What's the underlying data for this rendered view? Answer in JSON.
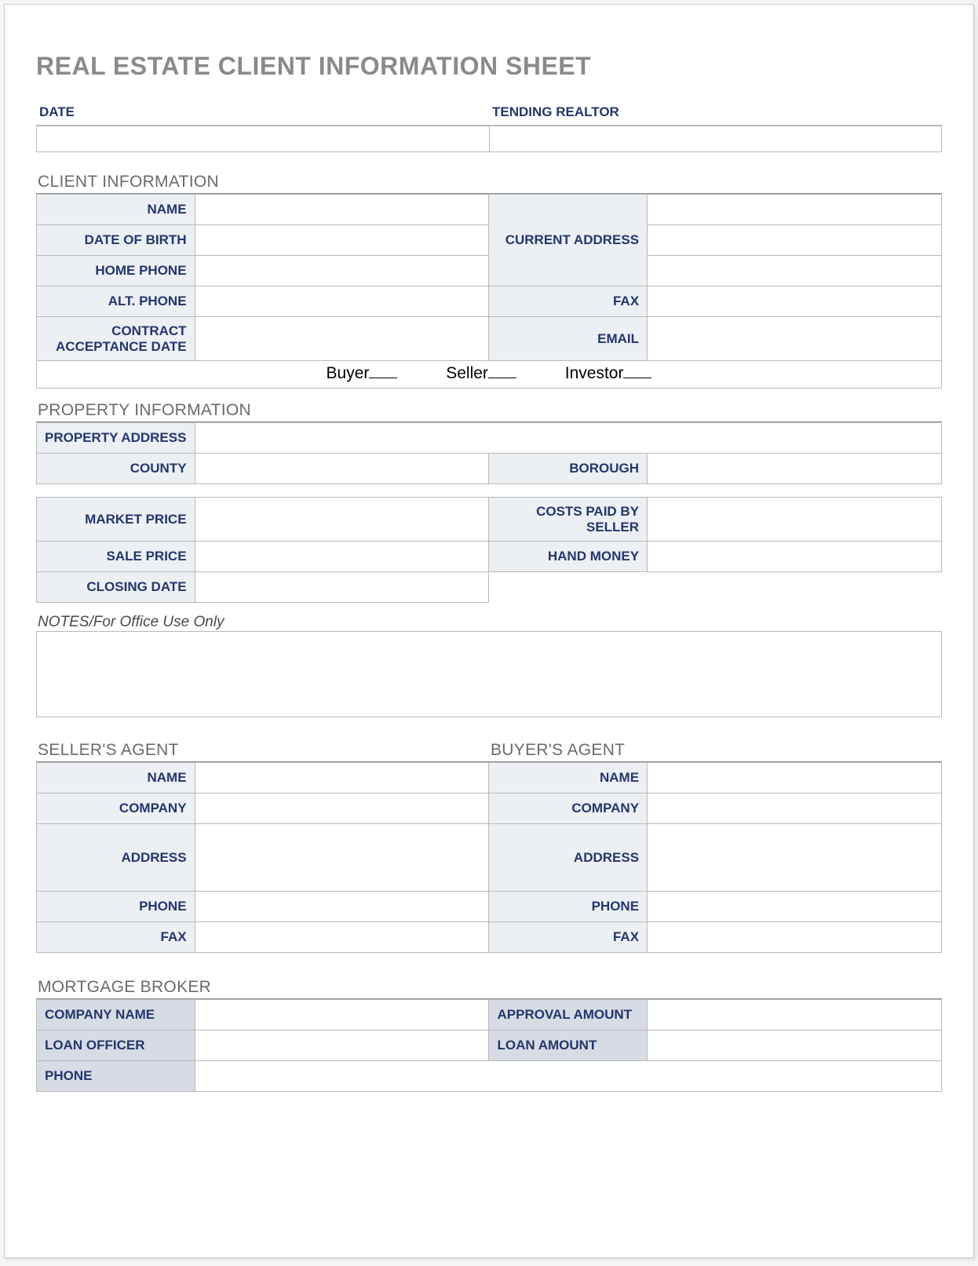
{
  "title": "REAL ESTATE CLIENT INFORMATION SHEET",
  "top": {
    "date_label": "DATE",
    "date_value": "",
    "realtor_label": "TENDING REALTOR",
    "realtor_value": ""
  },
  "client": {
    "heading": "CLIENT INFORMATION",
    "name_label": "NAME",
    "name_value": "",
    "dob_label": "DATE OF BIRTH",
    "dob_value": "",
    "home_phone_label": "HOME PHONE",
    "home_phone_value": "",
    "alt_phone_label": "ALT. PHONE",
    "alt_phone_value": "",
    "contract_label": "CONTRACT ACCEPTANCE DATE",
    "contract_value": "",
    "current_address_label": "CURRENT ADDRESS",
    "addr_line1": "",
    "addr_line2": "",
    "addr_line3": "",
    "fax_label": "FAX",
    "fax_value": "",
    "email_label": "EMAIL",
    "email_value": "",
    "roles": {
      "buyer": "Buyer",
      "seller": "Seller",
      "investor": "Investor"
    }
  },
  "property": {
    "heading": "PROPERTY INFORMATION",
    "address_label": "PROPERTY ADDRESS",
    "address_value": "",
    "county_label": "COUNTY",
    "county_value": "",
    "borough_label": "BOROUGH",
    "borough_value": "",
    "market_price_label": "MARKET PRICE",
    "market_price_value": "",
    "costs_label": "COSTS PAID BY SELLER",
    "costs_value": "",
    "sale_price_label": "SALE PRICE",
    "sale_price_value": "",
    "hand_money_label": "HAND MONEY",
    "hand_money_value": "",
    "closing_date_label": "CLOSING DATE",
    "closing_date_value": ""
  },
  "notes": {
    "label": "NOTES/For Office Use Only",
    "value": ""
  },
  "agents": {
    "seller_heading": "SELLER'S AGENT",
    "buyer_heading": "BUYER'S AGENT",
    "name_label": "NAME",
    "company_label": "COMPANY",
    "address_label": "ADDRESS",
    "phone_label": "PHONE",
    "fax_label": "FAX",
    "seller": {
      "name": "",
      "company": "",
      "address": "",
      "phone": "",
      "fax": ""
    },
    "buyer": {
      "name": "",
      "company": "",
      "address": "",
      "phone": "",
      "fax": ""
    }
  },
  "mortgage": {
    "heading": "MORTGAGE BROKER",
    "company_label": "COMPANY NAME",
    "company_value": "",
    "approval_label": "APPROVAL AMOUNT",
    "approval_value": "",
    "loan_officer_label": "LOAN OFFICER",
    "loan_officer_value": "",
    "loan_amount_label": "LOAN AMOUNT",
    "loan_amount_value": "",
    "phone_label": "PHONE",
    "phone_value": ""
  }
}
